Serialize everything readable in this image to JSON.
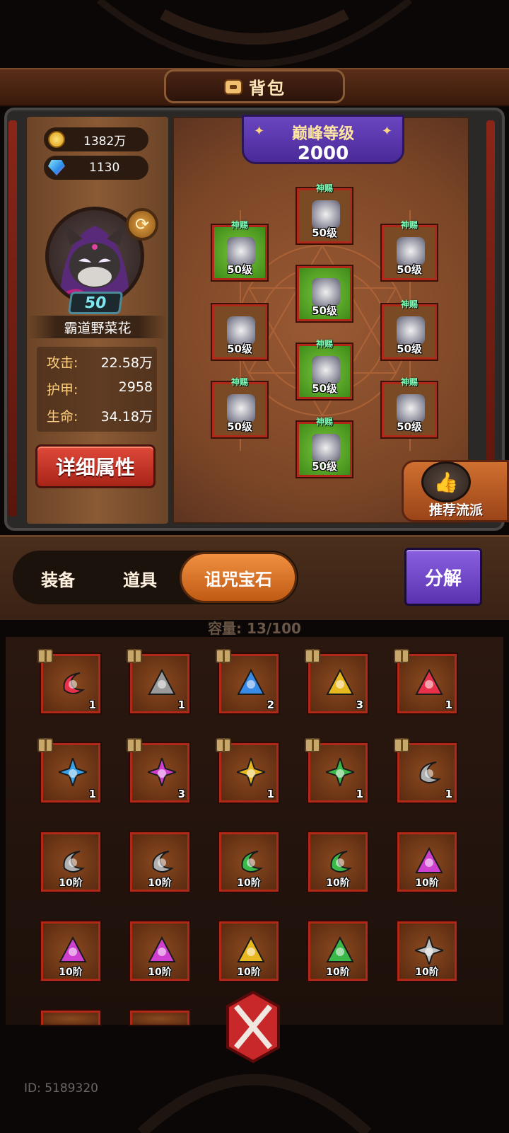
{
  "header": {
    "title": "背包",
    "icon": "bag-icon"
  },
  "currency": {
    "gold": "1382万",
    "diamond": "1130"
  },
  "hero": {
    "level": "50",
    "name": "霸道野菜花"
  },
  "stats": [
    {
      "label": "攻击:",
      "value": "22.58万"
    },
    {
      "label": "护甲:",
      "value": "2958"
    },
    {
      "label": "生命:",
      "value": "34.18万"
    }
  ],
  "detail_button": "详细属性",
  "peak": {
    "label": "巅峰等级",
    "value": "2000"
  },
  "equipment": [
    {
      "slot": "helmet",
      "tag": "神赐",
      "level": "50级",
      "color": "#7a4a24"
    },
    {
      "slot": "shoulder",
      "tag": "神赐",
      "level": "50级",
      "color": "#4aa024"
    },
    {
      "slot": "necklace",
      "tag": "神赐",
      "level": "50级",
      "color": "#7a4a24"
    },
    {
      "slot": "armor",
      "tag": "",
      "level": "50级",
      "color": "#4aa024"
    },
    {
      "slot": "gloves",
      "tag": "",
      "level": "50级",
      "color": "#7a4a24"
    },
    {
      "slot": "ring",
      "tag": "神赐",
      "level": "50级",
      "color": "#7a4a24"
    },
    {
      "slot": "pants",
      "tag": "神赐",
      "level": "50级",
      "color": "#4aa024"
    },
    {
      "slot": "weapon",
      "tag": "神赐",
      "level": "50级",
      "color": "#7a4a24"
    },
    {
      "slot": "offhand",
      "tag": "神赐",
      "level": "50级",
      "color": "#7a4a24"
    },
    {
      "slot": "boots",
      "tag": "神赐",
      "level": "50级",
      "color": "#4aa024"
    }
  ],
  "recommend": "推荐流派",
  "tabs": {
    "equipment": "装备",
    "items": "道具",
    "gems": "诅咒宝石"
  },
  "decompose": "分解",
  "capacity": {
    "label": "容量:",
    "value": "13/100"
  },
  "inventory": [
    {
      "kind": "crescent",
      "color": "#e8304a",
      "count": "1",
      "gift": true
    },
    {
      "kind": "tri",
      "color": "#9a9a9a",
      "count": "1",
      "gift": true
    },
    {
      "kind": "tri",
      "color": "#3a8ae8",
      "count": "2",
      "gift": true
    },
    {
      "kind": "tri",
      "color": "#e8b820",
      "count": "3",
      "gift": true
    },
    {
      "kind": "tri",
      "color": "#e8304a",
      "count": "1",
      "gift": true
    },
    {
      "kind": "star",
      "color": "#3aa0e8",
      "count": "1",
      "gift": true
    },
    {
      "kind": "star",
      "color": "#d040d0",
      "count": "3",
      "gift": true
    },
    {
      "kind": "star",
      "color": "#e8b820",
      "count": "1",
      "gift": true
    },
    {
      "kind": "star",
      "color": "#3ab84a",
      "count": "1",
      "gift": true
    },
    {
      "kind": "crescent",
      "color": "#b0b0b0",
      "count": "1",
      "gift": true
    },
    {
      "kind": "crescent",
      "color": "#b0b0b0",
      "count": "10阶",
      "gift": false
    },
    {
      "kind": "crescent",
      "color": "#b0b0b0",
      "count": "10阶",
      "gift": false
    },
    {
      "kind": "crescent",
      "color": "#3ab84a",
      "count": "10阶",
      "gift": false
    },
    {
      "kind": "crescent",
      "color": "#3ab84a",
      "count": "10阶",
      "gift": false
    },
    {
      "kind": "tri",
      "color": "#d040d0",
      "count": "10阶",
      "gift": false
    },
    {
      "kind": "tri",
      "color": "#d040d0",
      "count": "10阶",
      "gift": false
    },
    {
      "kind": "tri",
      "color": "#d040d0",
      "count": "10阶",
      "gift": false
    },
    {
      "kind": "tri",
      "color": "#e8b820",
      "count": "10阶",
      "gift": false
    },
    {
      "kind": "tri",
      "color": "#3ab84a",
      "count": "10阶",
      "gift": false
    },
    {
      "kind": "star",
      "color": "#c0c0c0",
      "count": "10阶",
      "gift": false
    }
  ],
  "user_id": "ID: 5189320"
}
